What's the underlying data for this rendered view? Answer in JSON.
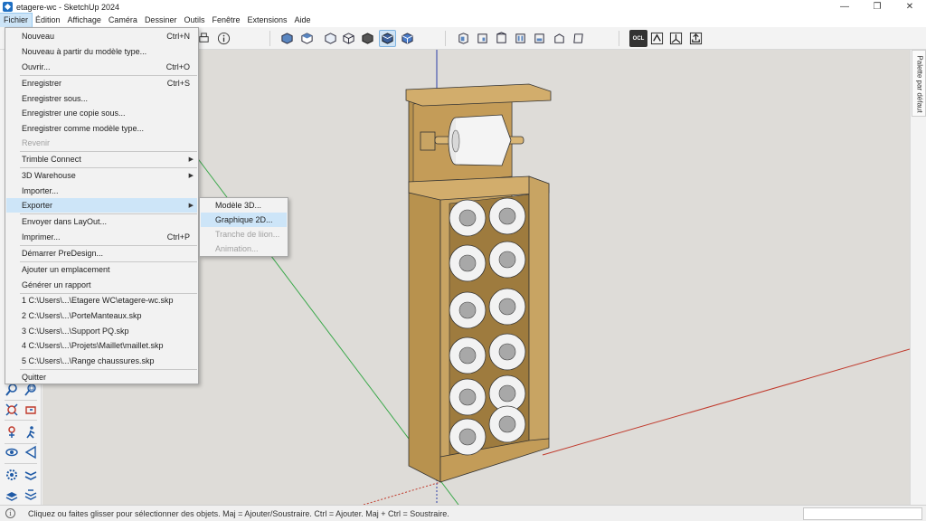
{
  "window": {
    "title": "etagere-wc - SketchUp 2024",
    "minimize": "—",
    "maximize": "❐",
    "close": "✕"
  },
  "menubar": {
    "items": [
      "Fichier",
      "Édition",
      "Affichage",
      "Caméra",
      "Dessiner",
      "Outils",
      "Fenêtre",
      "Extensions",
      "Aide"
    ]
  },
  "file_menu": {
    "items": [
      {
        "label": "Nouveau",
        "shortcut": "Ctrl+N"
      },
      {
        "label": "Nouveau à partir du modèle type...",
        "shortcut": ""
      },
      {
        "label": "Ouvrir...",
        "shortcut": "Ctrl+O"
      },
      {
        "label": "Enregistrer",
        "shortcut": "Ctrl+S"
      },
      {
        "label": "Enregistrer sous...",
        "shortcut": ""
      },
      {
        "label": "Enregistrer une copie sous...",
        "shortcut": ""
      },
      {
        "label": "Enregistrer comme modèle type...",
        "shortcut": ""
      },
      {
        "label": "Revenir",
        "shortcut": ""
      },
      {
        "label": "Trimble Connect",
        "shortcut": ""
      },
      {
        "label": "3D Warehouse",
        "shortcut": ""
      },
      {
        "label": "Importer...",
        "shortcut": ""
      },
      {
        "label": "Exporter",
        "shortcut": ""
      },
      {
        "label": "Envoyer dans LayOut...",
        "shortcut": ""
      },
      {
        "label": "Imprimer...",
        "shortcut": "Ctrl+P"
      },
      {
        "label": "Démarrer PreDesign...",
        "shortcut": ""
      },
      {
        "label": "Ajouter un emplacement",
        "shortcut": ""
      },
      {
        "label": "Générer un rapport",
        "shortcut": ""
      },
      {
        "label": "1 C:\\Users\\...\\Etagere WC\\etagere-wc.skp",
        "shortcut": ""
      },
      {
        "label": "2 C:\\Users\\...\\PorteManteaux.skp",
        "shortcut": ""
      },
      {
        "label": "3 C:\\Users\\...\\Support PQ.skp",
        "shortcut": ""
      },
      {
        "label": "4 C:\\Users\\...\\Projets\\Maillet\\maillet.skp",
        "shortcut": ""
      },
      {
        "label": "5 C:\\Users\\...\\Range chaussures.skp",
        "shortcut": ""
      },
      {
        "label": "Quitter",
        "shortcut": ""
      }
    ]
  },
  "export_submenu": {
    "items": [
      "Modèle 3D...",
      "Graphique 2D...",
      "Tranche de liion...",
      "Animation..."
    ]
  },
  "toolbar": {
    "ocl_label": "OCL"
  },
  "tray": {
    "label": "Palette par défaut"
  },
  "statusbar": {
    "info_icon": "i",
    "text": "Cliquez ou faites glisser pour sélectionner des objets. Maj = Ajouter/Soustraire. Ctrl = Ajouter. Maj + Ctrl = Soustraire."
  },
  "colors": {
    "viewport_bg": "#dedcd8",
    "wood": "#c8a463",
    "wood_dark": "#9c7a3c",
    "axis_red": "#c0392b",
    "axis_green": "#3aa84a",
    "axis_blue": "#2c3ea8",
    "menu_highlight": "#cde5f8"
  }
}
